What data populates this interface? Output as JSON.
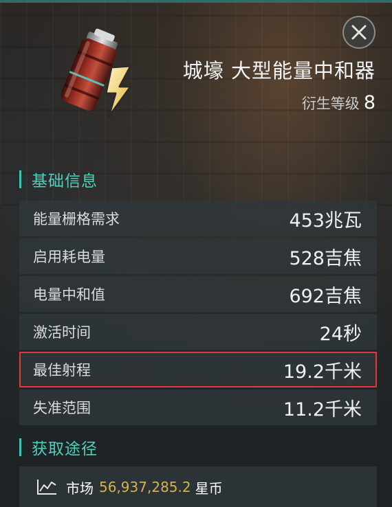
{
  "item": {
    "name": "城壕 大型能量中和器",
    "meta_label": "衍生等级",
    "meta_value": "8"
  },
  "sections": {
    "basic": "基础信息",
    "acquire": "获取途径"
  },
  "attributes": [
    {
      "label": "能量栅格需求",
      "value": "453兆瓦"
    },
    {
      "label": "启用耗电量",
      "value": "528吉焦"
    },
    {
      "label": "电量中和值",
      "value": "692吉焦"
    },
    {
      "label": "激活时间",
      "value": "24秒"
    },
    {
      "label": "最佳射程",
      "value": "19.2千米"
    },
    {
      "label": "失准范围",
      "value": "11.2千米"
    }
  ],
  "market": {
    "label": "市场",
    "price": "56,937,285.2",
    "currency": "星币"
  },
  "colors": {
    "accent": "#38c7b6",
    "highlight": "#e03a3e",
    "price": "#d6b24e"
  },
  "icons": {
    "close": "close-icon",
    "item": "energy-neutralizer-battery-icon",
    "market": "line-chart-icon"
  }
}
